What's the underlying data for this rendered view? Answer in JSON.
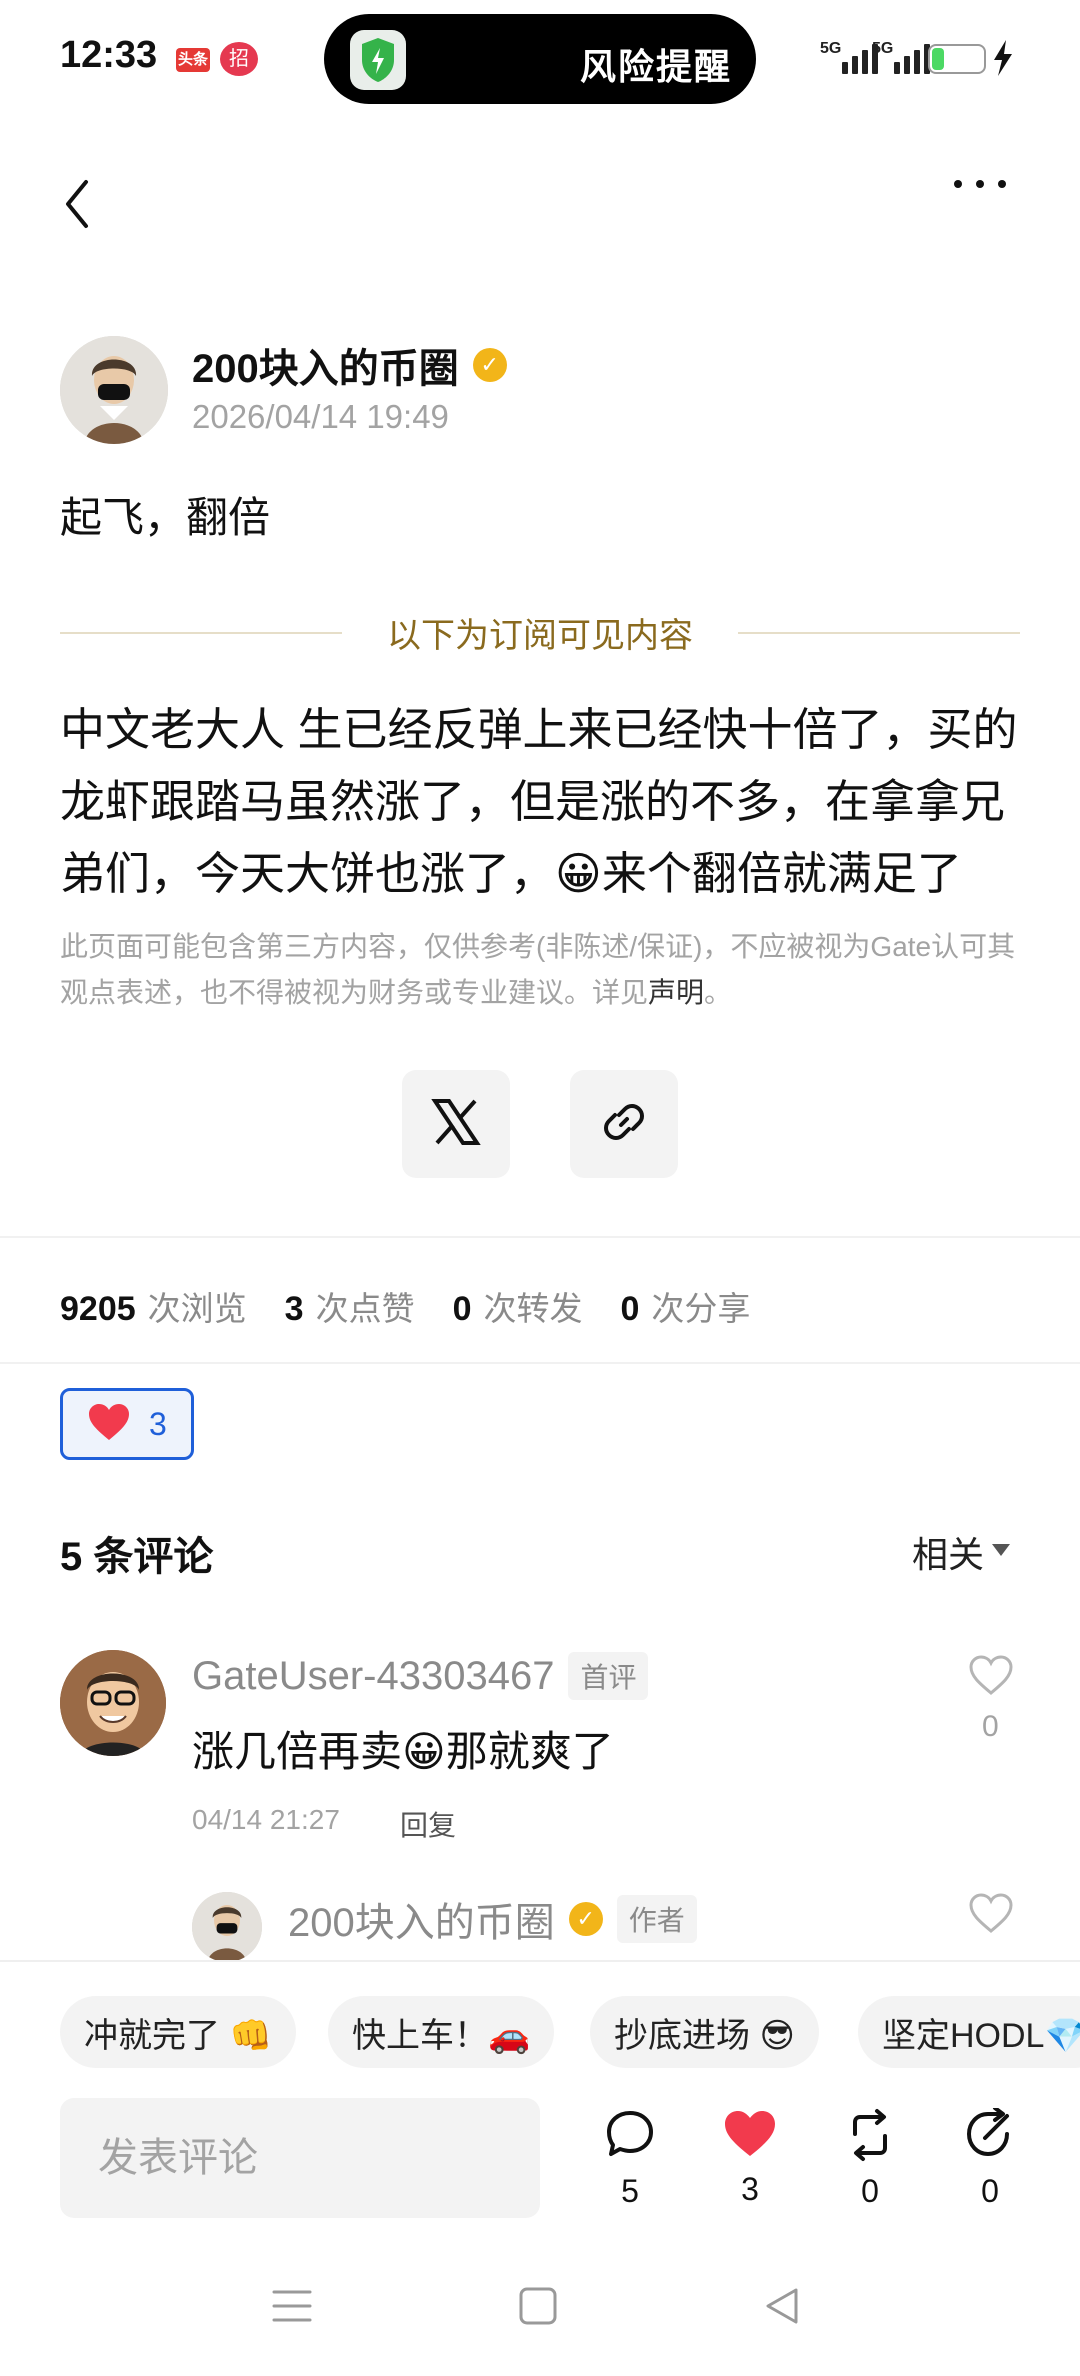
{
  "status_bar": {
    "time": "12:33",
    "badge_1": "头条",
    "badge_2": "招",
    "alert_text": "风险提醒",
    "signal_1": "5G",
    "signal_2": "5G",
    "battery": "22",
    "battery_level": 0.22
  },
  "post": {
    "author": "200块入的币圈",
    "timestamp": "2026/04/14 19:49",
    "headline": "起飞，翻倍",
    "divider_label": "以下为订阅可见内容",
    "body": "中文老大人 生已经反弹上来已经快十倍了，买的龙虾跟踏马虽然涨了，但是涨的不多，在拿拿兄弟们，今天大饼也涨了，😀来个翻倍就满足了",
    "disclaimer": "此页面可能包含第三方内容，仅供参考(非陈述/保证)，不应被视为Gate认可其观点表述，也不得被视为财务或专业建议。详见",
    "disclaimer_link": "声明",
    "disclaimer_end": "。"
  },
  "stats": {
    "views": "9205",
    "views_label": "次浏览",
    "likes": "3",
    "likes_label": "次点赞",
    "reposts": "0",
    "reposts_label": "次转发",
    "shares": "0",
    "shares_label": "次分享"
  },
  "reaction": {
    "count": "3"
  },
  "comments": {
    "title": "5 条评论",
    "sort": "相关",
    "items": [
      {
        "user": "GateUser-43303467",
        "tag": "首评",
        "text": "涨几倍再卖😀那就爽了",
        "time": "04/14 21:27",
        "reply": "回复",
        "likes": "0"
      }
    ],
    "reply": {
      "user": "200块入的币圈",
      "tag": "作者"
    }
  },
  "quick_replies": [
    "冲就完了 👊",
    "快上车！🚗",
    "抄底进场 😎",
    "坚定HODL💎"
  ],
  "composer": {
    "placeholder": "发表评论",
    "comment_count": "5",
    "like_count": "3",
    "repost_count": "0",
    "share_count": "0"
  },
  "colors": {
    "accent_blue": "#1f5fd9",
    "heart_red": "#f23a4d",
    "gold": "#8a6a1e",
    "verified": "#f2b519"
  }
}
